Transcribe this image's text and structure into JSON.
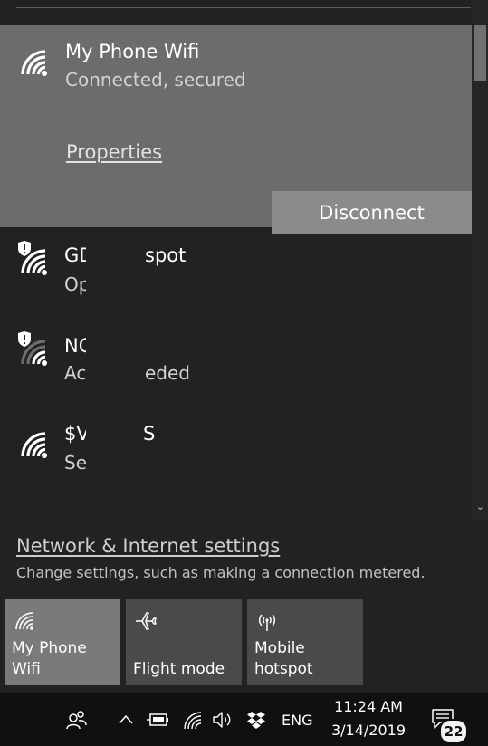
{
  "connected_network": {
    "name": "My Phone Wifi",
    "status": "Connected, secured",
    "properties_label": "Properties",
    "disconnect_label": "Disconnect"
  },
  "networks": [
    {
      "name_start": "GD",
      "name_end": "spot",
      "status_start": "Op",
      "status_end": "",
      "icon": "wifi-shield-icon"
    },
    {
      "name_start": "NC",
      "name_end": "",
      "status_start": "Ac",
      "status_end": "eded",
      "icon": "wifi-shield-icon"
    },
    {
      "name_start": "$V",
      "name_end": "S",
      "status_start": "Se",
      "status_end": "",
      "icon": "wifi-icon"
    }
  ],
  "settings": {
    "link": "Network & Internet settings",
    "description": "Change settings, such as making a connection metered."
  },
  "quick_actions": [
    {
      "label": "My Phone Wifi",
      "icon": "wifi-icon",
      "active": true
    },
    {
      "label": "Flight mode",
      "icon": "airplane-icon",
      "active": false
    },
    {
      "label": "Mobile hotspot",
      "icon": "hotspot-icon",
      "active": false
    }
  ],
  "taskbar": {
    "language": "ENG",
    "time": "11:24 AM",
    "date": "3/14/2019",
    "notification_count": "22"
  },
  "colors": {
    "connected_bg": "#6c6c6c",
    "flyout_bg": "#222222",
    "taskbar_bg": "#101010",
    "active_tile": "#7a7a7a"
  }
}
